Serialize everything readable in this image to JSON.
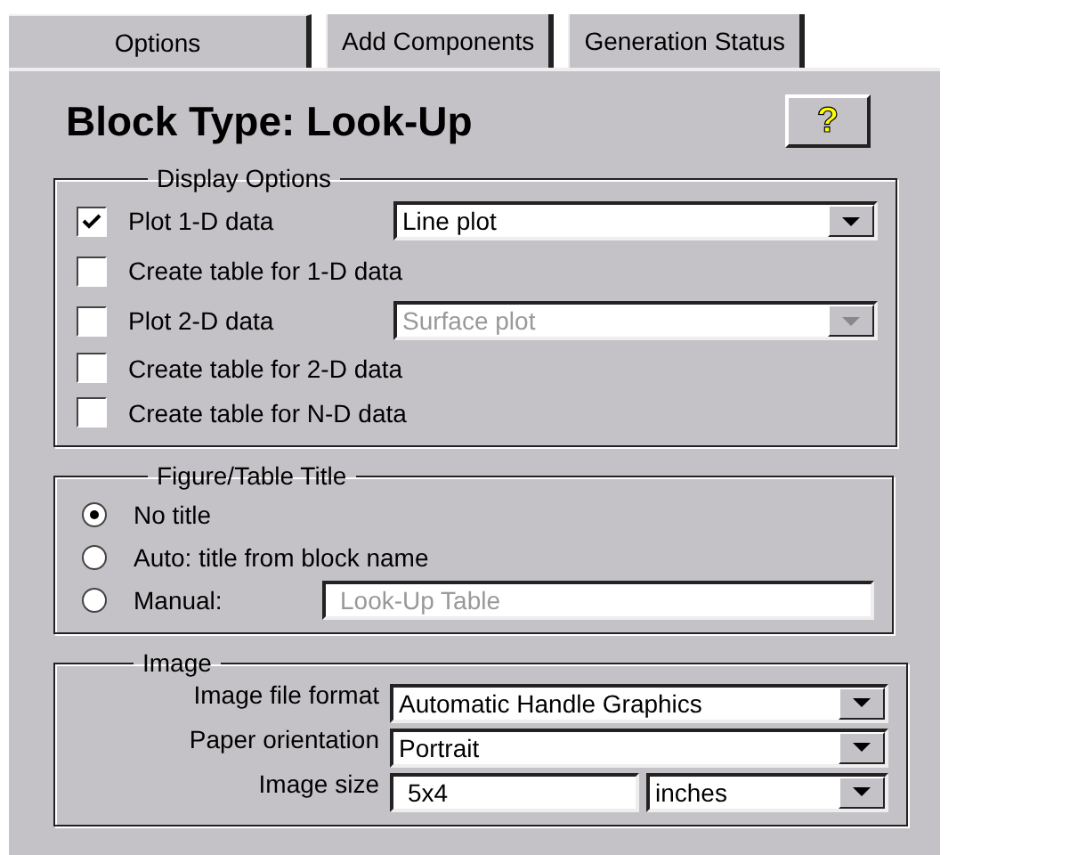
{
  "tabs": [
    {
      "label": "Options",
      "selected": true
    },
    {
      "label": "Add Components",
      "selected": false
    },
    {
      "label": "Generation Status",
      "selected": false
    }
  ],
  "title": "Block Type: Look-Up",
  "help_button": "?",
  "display_options": {
    "title": "Display Options",
    "rows": [
      {
        "label": "Plot 1-D data",
        "checked": true,
        "dropdown": {
          "value": "Line plot",
          "disabled": false
        }
      },
      {
        "label": "Create table for 1-D data",
        "checked": false
      },
      {
        "label": "Plot 2-D data",
        "checked": false,
        "dropdown": {
          "value": "Surface plot",
          "disabled": true
        }
      },
      {
        "label": "Create table for 2-D data",
        "checked": false
      },
      {
        "label": "Create table for N-D data",
        "checked": false
      }
    ]
  },
  "figure_title": {
    "title": "Figure/Table Title",
    "options": [
      {
        "label": "No title",
        "selected": true
      },
      {
        "label": "Auto: title from block name",
        "selected": false
      },
      {
        "label": "Manual:",
        "selected": false,
        "field": {
          "value": "Look-Up Table",
          "disabled": true
        }
      }
    ]
  },
  "image": {
    "title": "Image",
    "rows": [
      {
        "label": "Image file format",
        "fields": [
          {
            "kind": "dropdown",
            "value": "Automatic Handle Graphics"
          }
        ]
      },
      {
        "label": "Paper orientation",
        "fields": [
          {
            "kind": "dropdown",
            "value": "Portrait"
          }
        ]
      },
      {
        "label": "Image size",
        "fields": [
          {
            "kind": "text",
            "value": "5x4"
          },
          {
            "kind": "dropdown",
            "value": "inches"
          }
        ]
      }
    ]
  }
}
